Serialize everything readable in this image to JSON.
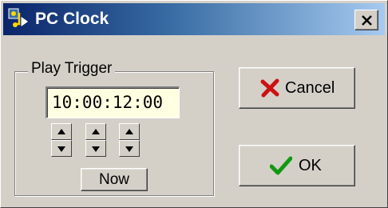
{
  "window": {
    "title": "PC Clock",
    "close_icon": "close-icon",
    "app_icon": "pc-clock-app-icon"
  },
  "play_trigger": {
    "group_label": "Play Trigger",
    "time_value": "10:00:12:00",
    "spinner_count": 3,
    "now_label": "Now"
  },
  "buttons": {
    "cancel_label": "Cancel",
    "cancel_icon": "red-x-icon",
    "ok_label": "OK",
    "ok_icon": "green-check-icon"
  },
  "colors": {
    "title_gradient_start": "#0a246a",
    "title_gradient_end": "#a6caf0",
    "face": "#d4d0c8",
    "field_background": "#ffffe1",
    "cancel_icon": "#cc1111",
    "ok_icon": "#119911"
  }
}
